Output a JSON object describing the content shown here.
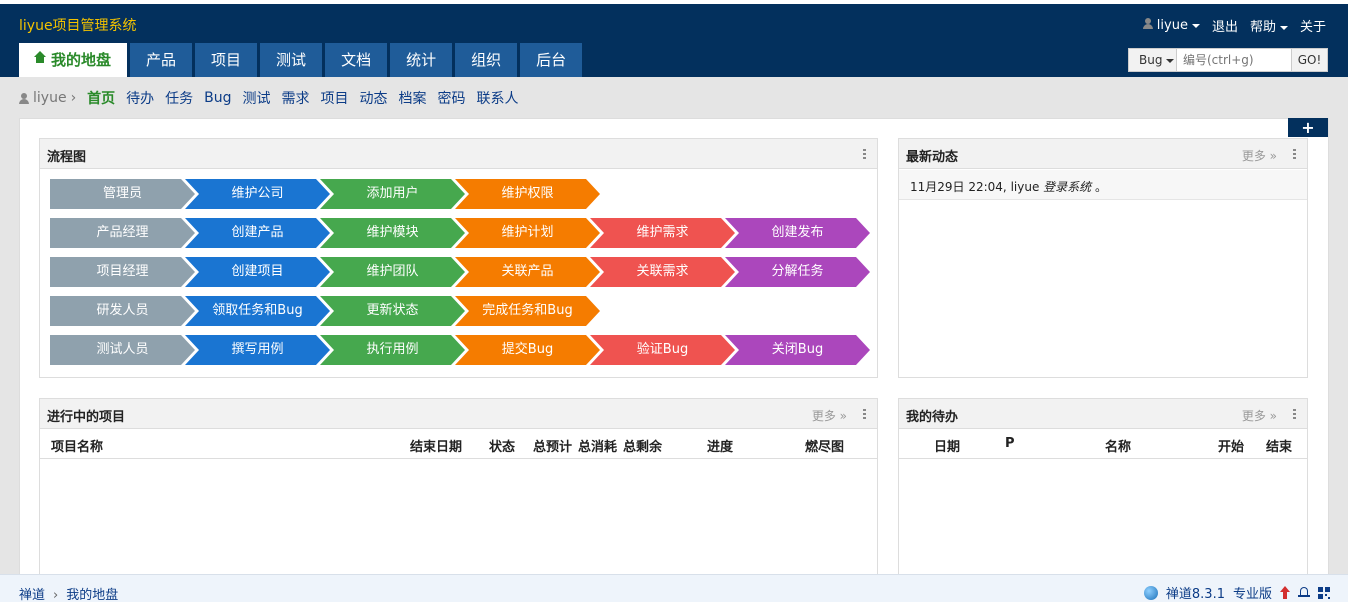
{
  "header": {
    "brand": "liyue项目管理系统",
    "user_menu": "liyue",
    "logout": "退出",
    "help": "帮助",
    "about": "关于",
    "nav": [
      "我的地盘",
      "产品",
      "项目",
      "测试",
      "文档",
      "统计",
      "组织",
      "后台"
    ],
    "search": {
      "type": "Bug",
      "placeholder": "编号(ctrl+g)",
      "go": "GO!"
    }
  },
  "subnav": {
    "user": "liyue",
    "items": [
      "首页",
      "待办",
      "任务",
      "Bug",
      "测试",
      "需求",
      "项目",
      "动态",
      "档案",
      "密码",
      "联系人"
    ]
  },
  "add_block": "+",
  "flow": {
    "title": "流程图",
    "rows": [
      [
        "管理员",
        "维护公司",
        "添加用户",
        "维护权限"
      ],
      [
        "产品经理",
        "创建产品",
        "维护模块",
        "维护计划",
        "维护需求",
        "创建发布"
      ],
      [
        "项目经理",
        "创建项目",
        "维护团队",
        "关联产品",
        "关联需求",
        "分解任务"
      ],
      [
        "研发人员",
        "领取任务和Bug",
        "更新状态",
        "完成任务和Bug"
      ],
      [
        "测试人员",
        "撰写用例",
        "执行用例",
        "提交Bug",
        "验证Bug",
        "关闭Bug"
      ]
    ]
  },
  "dynamics": {
    "title": "最新动态",
    "more": "更多 »",
    "entry_time": "11月29日 22:04, liyue",
    "entry_action": "登录系统",
    "entry_end": "。"
  },
  "projects": {
    "title": "进行中的项目",
    "more": "更多 »",
    "columns": [
      "项目名称",
      "结束日期",
      "状态",
      "总预计",
      "总消耗",
      "总剩余",
      "进度",
      "燃尽图"
    ]
  },
  "todos": {
    "title": "我的待办",
    "more": "更多 »",
    "columns": [
      "日期",
      "P",
      "名称",
      "开始",
      "结束"
    ]
  },
  "footer": {
    "crumb_root": "禅道",
    "crumb_current": "我的地盘",
    "version": "禅道8.3.1",
    "edition": "专业版"
  }
}
